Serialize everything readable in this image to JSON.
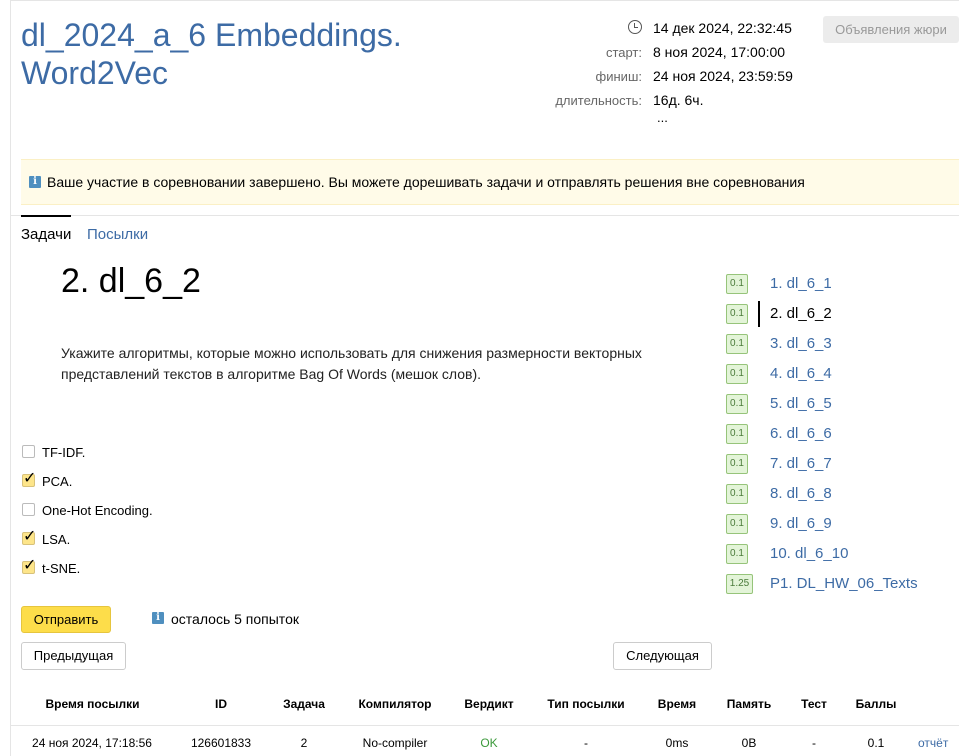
{
  "contest": {
    "title": "dl_2024_a_6 Embeddings. Word2Vec",
    "now": "14 дек 2024, 22:32:45",
    "start_label": "старт:",
    "start_value": "8 ноя 2024, 17:00:00",
    "finish_label": "финиш:",
    "finish_value": "24 ноя 2024, 23:59:59",
    "duration_label": "длительность:",
    "duration_value": "16д. 6ч.",
    "more": "...",
    "jury_button": "Объявления жюри"
  },
  "banner": {
    "text": "Ваше участие в соревновании завершено. Вы можете дорешивать задачи и отправлять решения вне соревнования"
  },
  "tabs": [
    {
      "label": "Задачи",
      "active": true
    },
    {
      "label": "Посылки",
      "active": false
    }
  ],
  "problem": {
    "title": "2. dl_6_2",
    "statement": "Укажите алгоритмы, которые можно использовать для снижения размерности векторных представлений текстов в алгоритме Bag Of Words (мешок слов).",
    "options": [
      {
        "label": "TF-IDF.",
        "checked": false
      },
      {
        "label": "PCA.",
        "checked": true
      },
      {
        "label": "One-Hot Encoding.",
        "checked": false
      },
      {
        "label": "LSA.",
        "checked": true
      },
      {
        "label": "t-SNE.",
        "checked": true
      }
    ],
    "submit_label": "Отправить",
    "attempts_text": "осталось 5 попыток",
    "prev_label": "Предыдущая",
    "next_label": "Следующая"
  },
  "problem_list": [
    {
      "score": "0.1",
      "name": "1. dl_6_1",
      "current": false
    },
    {
      "score": "0.1",
      "name": "2. dl_6_2",
      "current": true
    },
    {
      "score": "0.1",
      "name": "3. dl_6_3",
      "current": false
    },
    {
      "score": "0.1",
      "name": "4. dl_6_4",
      "current": false
    },
    {
      "score": "0.1",
      "name": "5. dl_6_5",
      "current": false
    },
    {
      "score": "0.1",
      "name": "6. dl_6_6",
      "current": false
    },
    {
      "score": "0.1",
      "name": "7. dl_6_7",
      "current": false
    },
    {
      "score": "0.1",
      "name": "8. dl_6_8",
      "current": false
    },
    {
      "score": "0.1",
      "name": "9. dl_6_9",
      "current": false
    },
    {
      "score": "0.1",
      "name": "10. dl_6_10",
      "current": false
    },
    {
      "score": "1.25",
      "name": "P1. DL_HW_06_Texts",
      "current": false
    }
  ],
  "submissions": {
    "headers": [
      "Время посылки",
      "ID",
      "Задача",
      "Компилятор",
      "Вердикт",
      "Тип посылки",
      "Время",
      "Память",
      "Тест",
      "Баллы"
    ],
    "rows": [
      {
        "time": "24 ноя 2024, 17:18:56",
        "id": "126601833",
        "task": "2",
        "compiler": "No-compiler",
        "verdict": "OK",
        "type": "-",
        "run_time": "0ms",
        "memory": "0B",
        "test": "-",
        "score": "0.1",
        "report": "отчёт"
      }
    ]
  },
  "colors": {
    "link": "#3d6ba5",
    "ok": "#3c9a3c",
    "submit": "#fddd4a",
    "banner_bg": "#fffbe8"
  }
}
